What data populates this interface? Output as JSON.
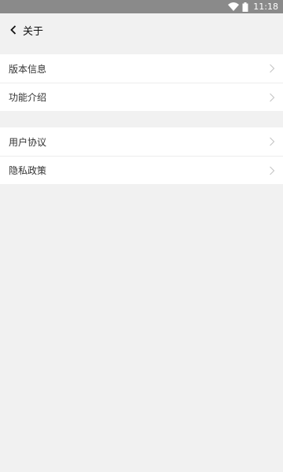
{
  "status_bar": {
    "time": "11:18"
  },
  "header": {
    "title": "关于",
    "back_icon": "chevron-left-icon"
  },
  "groups": [
    {
      "items": [
        {
          "label": "版本信息"
        },
        {
          "label": "功能介绍"
        }
      ]
    },
    {
      "items": [
        {
          "label": "用户协议"
        },
        {
          "label": "隐私政策"
        }
      ]
    }
  ],
  "colors": {
    "background": "#f1f1f1",
    "status_bar": "#8a8a8a",
    "chevron": "#c8c8c8"
  }
}
